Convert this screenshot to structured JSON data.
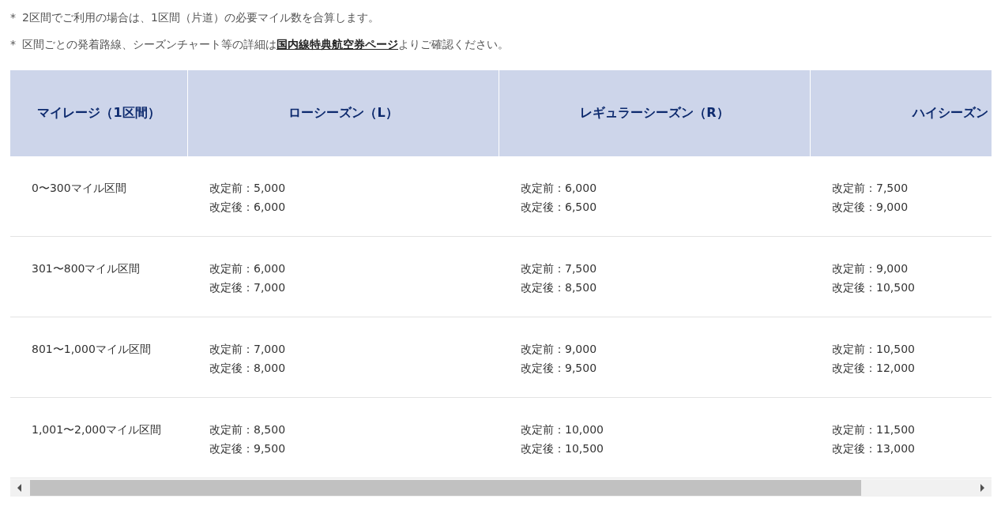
{
  "notes": [
    {
      "marker": "*",
      "segments": [
        {
          "kind": "text",
          "text": "2区間でご利用の場合は、1区間（片道）の必要マイル数を合算します。"
        }
      ]
    },
    {
      "marker": "*",
      "segments": [
        {
          "kind": "text",
          "text": "区間ごとの発着路線、シーズンチャート等の詳細は"
        },
        {
          "kind": "link",
          "text": "国内線特典航空券ページ"
        },
        {
          "kind": "text",
          "text": "よりご確認ください。"
        }
      ]
    }
  ],
  "table": {
    "columns": [
      "マイレージ（1区間）",
      "ローシーズン（L）",
      "レギュラーシーズン（R）",
      "ハイシーズン"
    ],
    "rows": [
      {
        "range": "0〜300マイル区間",
        "cells": [
          [
            "改定前：5,000",
            "改定後：6,000"
          ],
          [
            "改定前：6,000",
            "改定後：6,500"
          ],
          [
            "改定前：7,500",
            "改定後：9,000"
          ]
        ]
      },
      {
        "range": "301〜800マイル区間",
        "cells": [
          [
            "改定前：6,000",
            "改定後：7,000"
          ],
          [
            "改定前：7,500",
            "改定後：8,500"
          ],
          [
            "改定前：9,000",
            "改定後：10,500"
          ]
        ]
      },
      {
        "range": "801〜1,000マイル区間",
        "cells": [
          [
            "改定前：7,000",
            "改定後：8,000"
          ],
          [
            "改定前：9,000",
            "改定後：9,500"
          ],
          [
            "改定前：10,500",
            "改定後：12,000"
          ]
        ]
      },
      {
        "range": "1,001〜2,000マイル区間",
        "cells": [
          [
            "改定前：8,500",
            "改定後：9,500"
          ],
          [
            "改定前：10,000",
            "改定後：10,500"
          ],
          [
            "改定前：11,500",
            "改定後：13,000"
          ]
        ]
      }
    ]
  }
}
